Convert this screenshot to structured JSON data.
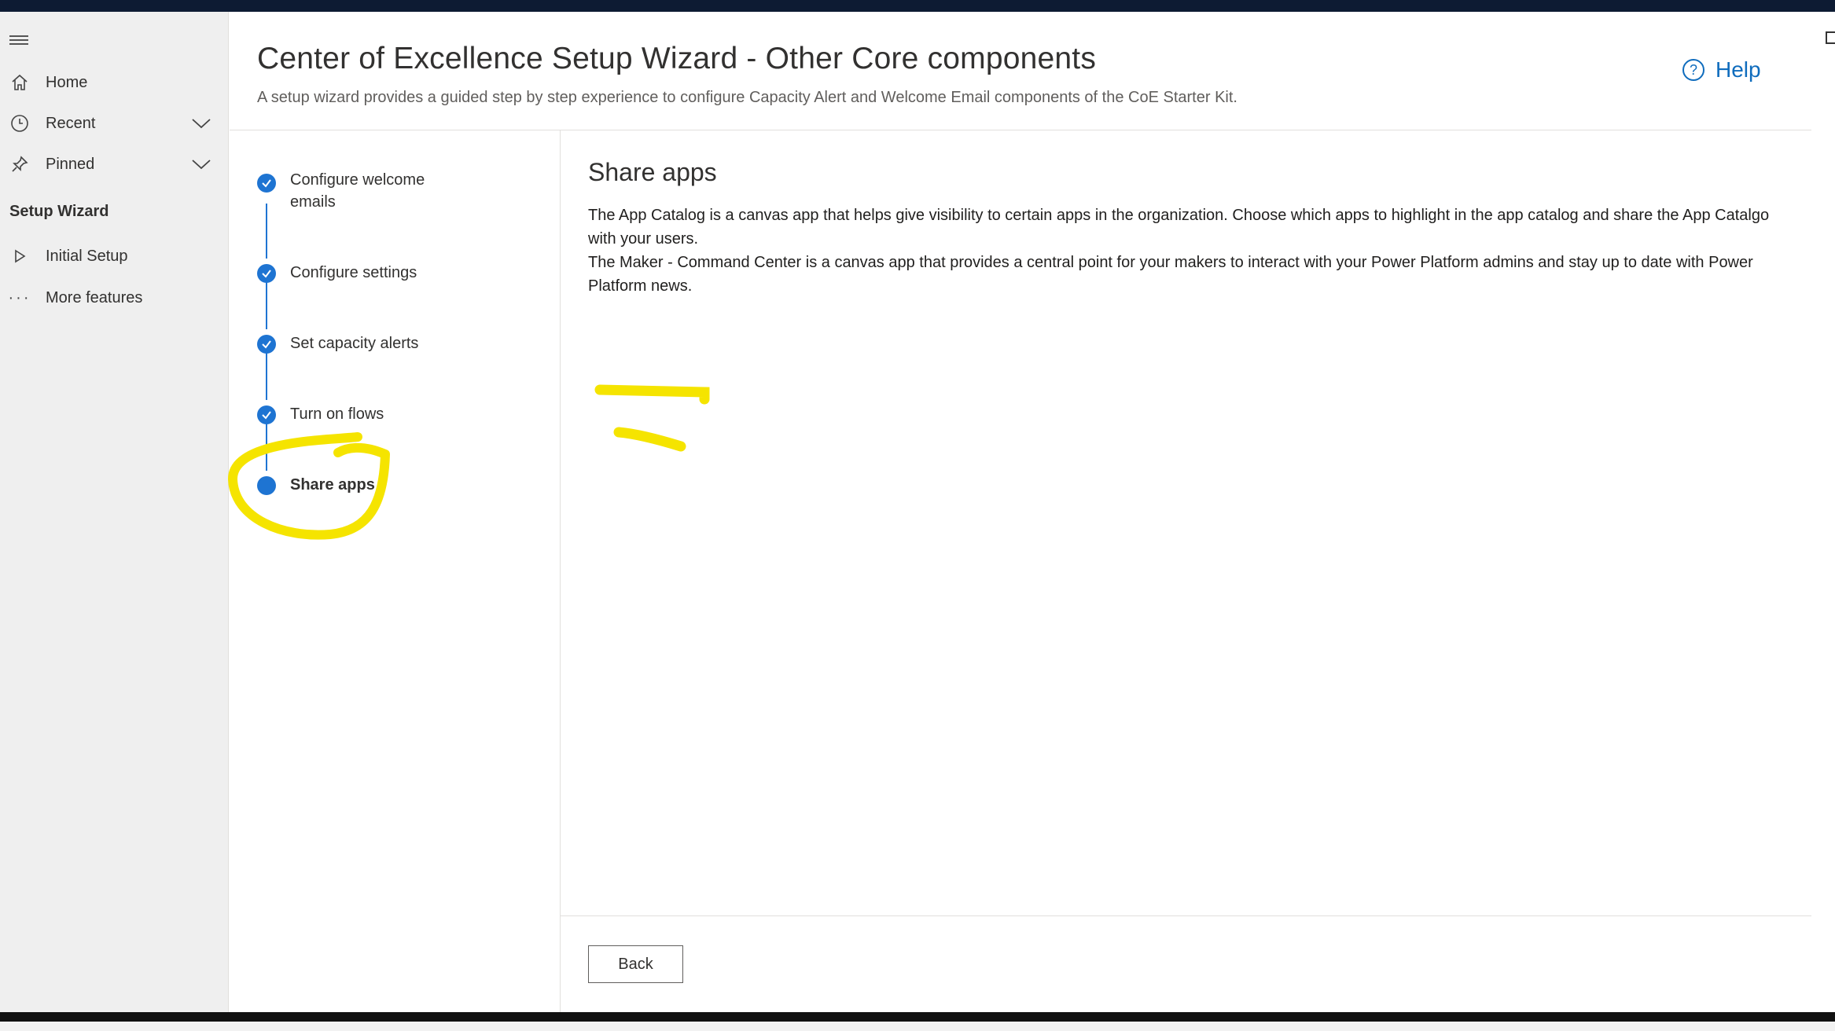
{
  "nav": {
    "items": [
      {
        "label": "Home",
        "icon": "home-icon"
      },
      {
        "label": "Recent",
        "icon": "clock-icon"
      },
      {
        "label": "Pinned",
        "icon": "pin-icon"
      }
    ],
    "section_title": "Setup Wizard",
    "section_items": [
      {
        "label": "Initial Setup",
        "icon": "play-icon"
      },
      {
        "label": "More features",
        "icon": "ellipsis-icon"
      }
    ]
  },
  "header": {
    "title": "Center of Excellence Setup Wizard - Other Core components",
    "subtitle": "A setup wizard provides a guided step by step experience to configure Capacity Alert and Welcome Email components of the CoE Starter Kit.",
    "help_label": "Help"
  },
  "steps": [
    {
      "line1": "Configure welcome",
      "line2": "emails",
      "status": "complete"
    },
    {
      "line1": "Configure settings",
      "status": "complete"
    },
    {
      "line1": "Set capacity alerts",
      "status": "complete"
    },
    {
      "line1": "Turn on flows",
      "status": "complete"
    },
    {
      "line1": "Share apps",
      "status": "current"
    }
  ],
  "content": {
    "heading": "Share apps",
    "para1": "The App Catalog is a canvas app that helps give visibility to certain apps in the organization. Choose which apps to highlight in the app catalog and share the App Catalgo with your users.",
    "para2": "The Maker - Command Center is a canvas app that provides a central point for your makers to interact with your Power Platform admins and stay up to date with Power Platform news."
  },
  "footer": {
    "back_label": "Back"
  },
  "colors": {
    "accent": "#1e74d2",
    "highlight": "#f5e400",
    "help": "#0f6cbd"
  }
}
